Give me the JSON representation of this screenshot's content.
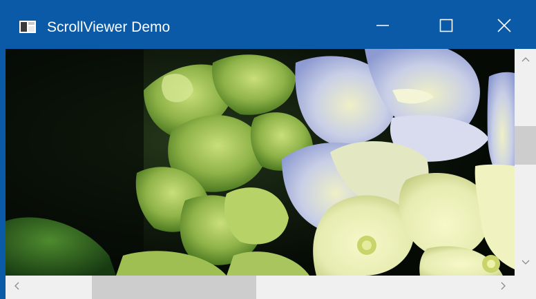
{
  "window": {
    "title": "ScrollViewer Demo",
    "app_icon": "window-app-icon",
    "controls": {
      "minimize_icon": "minimize-icon",
      "maximize_icon": "maximize-icon",
      "close_icon": "close-icon"
    }
  },
  "colors": {
    "titlebar": "#0a5aa8",
    "title_text": "#ffffff",
    "scrollbar_track": "#f0f0f0",
    "scrollbar_thumb": "#cdcdcd",
    "scroll_arrow": "#8a8a8a"
  },
  "content": {
    "image_subject": "hydrangea-flowers-photo"
  },
  "scrollbars": {
    "vertical": {
      "up_icon": "chevron-up-icon",
      "down_icon": "chevron-down-icon"
    },
    "horizontal": {
      "left_icon": "chevron-left-icon",
      "right_icon": "chevron-right-icon"
    }
  }
}
